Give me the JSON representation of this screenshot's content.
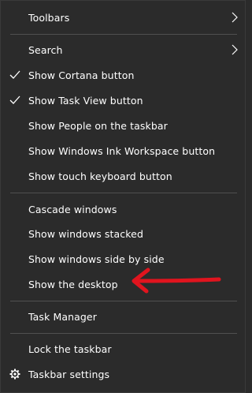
{
  "menu": {
    "items": [
      {
        "label": "Toolbars",
        "submenu": true,
        "checked": false
      },
      {
        "label": "Search",
        "submenu": true,
        "checked": false
      },
      {
        "label": "Show Cortana button",
        "submenu": false,
        "checked": true
      },
      {
        "label": "Show Task View button",
        "submenu": false,
        "checked": true
      },
      {
        "label": "Show People on the taskbar",
        "submenu": false,
        "checked": false
      },
      {
        "label": "Show Windows Ink Workspace button",
        "submenu": false,
        "checked": false
      },
      {
        "label": "Show touch keyboard button",
        "submenu": false,
        "checked": false
      },
      {
        "label": "Cascade windows",
        "submenu": false,
        "checked": false
      },
      {
        "label": "Show windows stacked",
        "submenu": false,
        "checked": false
      },
      {
        "label": "Show windows side by side",
        "submenu": false,
        "checked": false
      },
      {
        "label": "Show the desktop",
        "submenu": false,
        "checked": false
      },
      {
        "label": "Task Manager",
        "submenu": false,
        "checked": false
      },
      {
        "label": "Lock the taskbar",
        "submenu": false,
        "checked": false
      },
      {
        "label": "Taskbar settings",
        "submenu": false,
        "checked": false,
        "icon": "gear-icon"
      }
    ]
  },
  "annotation": {
    "icon": "red-arrow-icon",
    "color": "#e0141e"
  },
  "colors": {
    "background": "#2b2b2b",
    "text": "#ffffff",
    "separator": "#505050"
  }
}
